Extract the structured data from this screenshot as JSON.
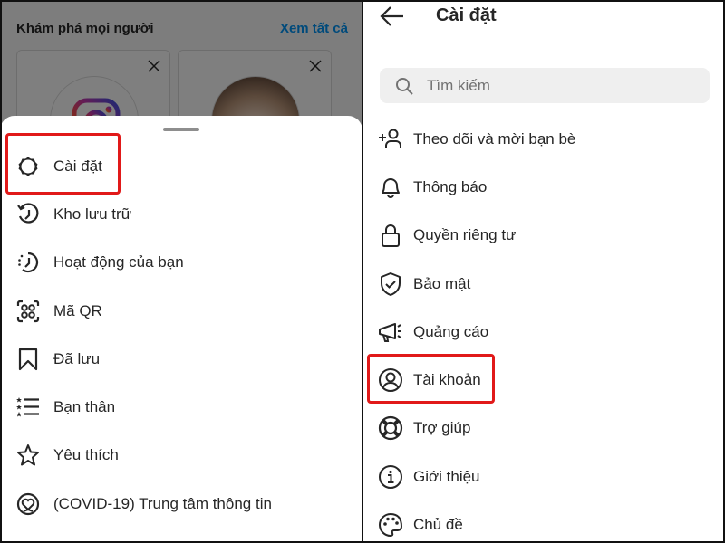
{
  "left_panel": {
    "discover": {
      "title": "Khám phá mọi người",
      "see_all": "Xem tất cả"
    },
    "sheet_menu": {
      "items": [
        {
          "label": "Cài đặt",
          "icon": "gear-icon",
          "highlighted": true
        },
        {
          "label": "Kho lưu trữ",
          "icon": "archive-history-icon"
        },
        {
          "label": "Hoạt động của bạn",
          "icon": "activity-clock-icon"
        },
        {
          "label": "Mã QR",
          "icon": "qr-code-icon"
        },
        {
          "label": "Đã lưu",
          "icon": "bookmark-icon"
        },
        {
          "label": "Bạn thân",
          "icon": "close-friends-list-icon"
        },
        {
          "label": "Yêu thích",
          "icon": "star-icon"
        },
        {
          "label": "(COVID-19) Trung tâm thông tin",
          "icon": "covid-heart-icon"
        }
      ]
    }
  },
  "right_panel": {
    "header": {
      "title": "Cài đặt",
      "back_icon": "arrow-left-icon"
    },
    "search": {
      "placeholder": "Tìm kiếm",
      "value": ""
    },
    "settings": {
      "items": [
        {
          "label": "Theo dõi và mời bạn bè",
          "icon": "add-user-icon"
        },
        {
          "label": "Thông báo",
          "icon": "bell-icon"
        },
        {
          "label": "Quyền riêng tư",
          "icon": "lock-icon"
        },
        {
          "label": "Bảo mật",
          "icon": "shield-check-icon"
        },
        {
          "label": "Quảng cáo",
          "icon": "megaphone-icon"
        },
        {
          "label": "Tài khoản",
          "icon": "account-circle-icon",
          "highlighted": true
        },
        {
          "label": "Trợ giúp",
          "icon": "lifebuoy-icon"
        },
        {
          "label": "Giới thiệu",
          "icon": "info-icon"
        },
        {
          "label": "Chủ đề",
          "icon": "palette-icon"
        }
      ]
    }
  },
  "colors": {
    "highlight_border": "#e11919",
    "link_blue": "#0095f6",
    "text_primary": "#262626",
    "search_bg": "#efefef"
  }
}
